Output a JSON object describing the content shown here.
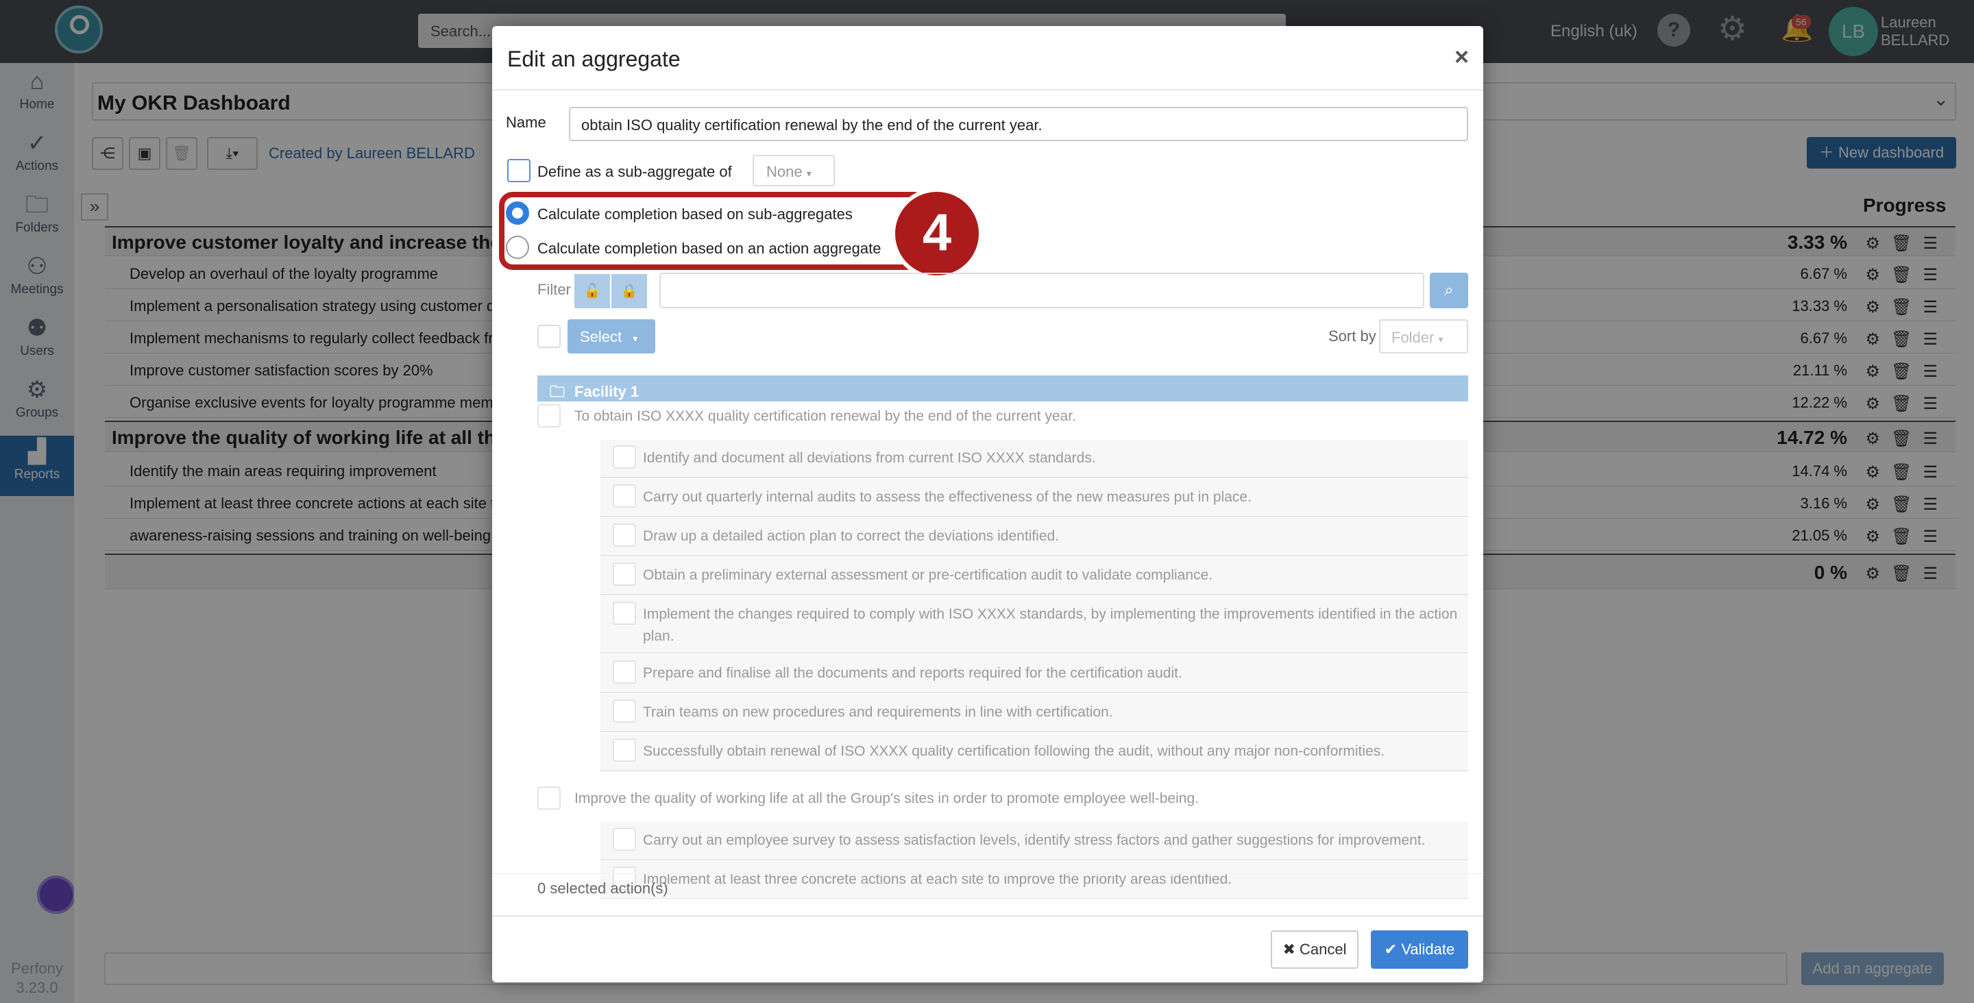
{
  "topbar": {
    "search_placeholder": "Search...",
    "language": "English (uk)",
    "notifications_count": "56",
    "user_initials": "LB",
    "user_first": "Laureen",
    "user_last": "BELLARD"
  },
  "sidebar": {
    "items": [
      {
        "label": "Home",
        "icon": "home-icon"
      },
      {
        "label": "Actions",
        "icon": "check-circle-icon"
      },
      {
        "label": "Folders",
        "icon": "folder-icon"
      },
      {
        "label": "Meetings",
        "icon": "people-icon"
      },
      {
        "label": "Users",
        "icon": "user-gear-icon"
      },
      {
        "label": "Groups",
        "icon": "group-gear-icon"
      },
      {
        "label": "Reports",
        "icon": "bar-chart-icon"
      }
    ],
    "version_name": "Perfony",
    "version_number": "3.23.0"
  },
  "dashboard": {
    "title": "My OKR Dashboard",
    "created_by": "Created by Laureen BELLARD",
    "new_dashboard": "New dashboard",
    "progress_header": "Progress",
    "add_aggregate": "Add an aggregate",
    "rows": [
      {
        "label": "Improve customer loyalty and increase the",
        "pct": "3.33 %",
        "bold": true
      },
      {
        "label": "Develop an overhaul of the loyalty programme",
        "pct": "6.67 %",
        "bold": false
      },
      {
        "label": "Implement a personalisation strategy using customer da",
        "pct": "13.33 %",
        "bold": false
      },
      {
        "label": "Implement mechanisms to regularly collect feedback fro",
        "pct": "6.67 %",
        "bold": false
      },
      {
        "label": "Improve customer satisfaction scores by 20%",
        "pct": "21.11 %",
        "bold": false
      },
      {
        "label": "Organise exclusive events for loyalty programme memb",
        "pct": "12.22 %",
        "bold": false
      },
      {
        "label": "Improve the quality of working life at all the",
        "pct": "14.72 %",
        "bold": true
      },
      {
        "label": "Identify the main areas requiring improvement",
        "pct": "14.74 %",
        "bold": false
      },
      {
        "label": "Implement at least three concrete actions at each site to",
        "pct": "3.16 %",
        "bold": false
      },
      {
        "label": "awareness-raising sessions and training on well-being a",
        "pct": "21.05 %",
        "bold": false
      },
      {
        "label": "",
        "pct": "0 %",
        "bold": true
      }
    ]
  },
  "modal": {
    "title": "Edit an aggregate",
    "close": "×",
    "name_label": "Name",
    "name_value": "obtain ISO quality certification renewal by the end of the current year.",
    "sub_aggregate_label": "Define as a sub-aggregate of",
    "sub_aggregate_value": "None",
    "radio_sub": "Calculate completion based on sub-aggregates",
    "radio_action": "Calculate completion based on an action aggregate",
    "step_number": "4",
    "filter_label": "Filter",
    "select_label": "Select",
    "sort_label": "Sort by",
    "sort_value": "Folder",
    "facility": "Facility 1",
    "items": [
      {
        "text": "To obtain ISO XXXX quality certification renewal by the end of the current year.",
        "level": "parent"
      },
      {
        "text": "Identify and document all deviations from current ISO XXXX standards.",
        "level": "child"
      },
      {
        "text": "Carry out quarterly internal audits to assess the effectiveness of the new measures put in place.",
        "level": "child"
      },
      {
        "text": "Draw up a detailed action plan to correct the deviations identified.",
        "level": "child"
      },
      {
        "text": "Obtain a preliminary external assessment or pre-certification audit to validate compliance.",
        "level": "child"
      },
      {
        "text": "Implement the changes required to comply with ISO XXXX standards, by implementing the improvements identified in the action plan.",
        "level": "child"
      },
      {
        "text": "Prepare and finalise all the documents and reports required for the certification audit.",
        "level": "child"
      },
      {
        "text": "Train teams on new procedures and requirements in line with certification.",
        "level": "child"
      },
      {
        "text": "Successfully obtain renewal of ISO XXXX quality certification following the audit, without any major non-conformities.",
        "level": "child"
      },
      {
        "text": "Improve the quality of working life at all the Group's sites in order to promote employee well-being.",
        "level": "parent"
      },
      {
        "text": "Carry out an employee survey to assess satisfaction levels, identify stress factors and gather suggestions for improvement.",
        "level": "child"
      },
      {
        "text": "Implement at least three concrete actions at each site to improve the priority areas identified.",
        "level": "child"
      }
    ],
    "selected_count": "0 selected action(s)",
    "cancel": "Cancel",
    "validate": "Validate"
  }
}
